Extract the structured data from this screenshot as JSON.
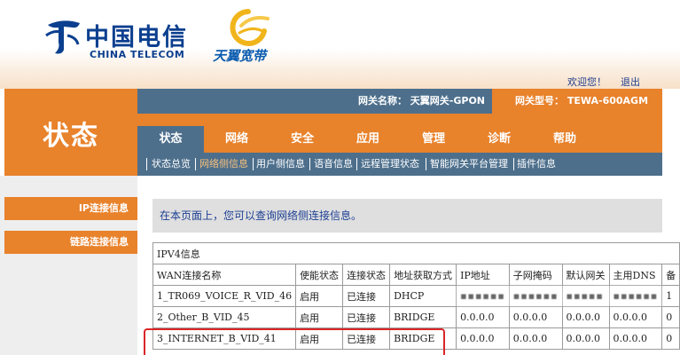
{
  "header": {
    "logo_cn": "中国电信",
    "logo_en": "CHINA TELECOM",
    "brand": "天翼宽带",
    "welcome": "欢迎您！",
    "logout": "退出",
    "colors": {
      "primary_orange": "#e8822b",
      "steel_blue": "#4d6f8c",
      "logo_blue": "#0b3f8f"
    }
  },
  "page_title": "状态",
  "info": {
    "gateway_name": "网关名称：  天翼网关-GPON",
    "gateway_model": "网关型号：  TEWA-600AGM"
  },
  "tabs": [
    "状态",
    "网络",
    "安全",
    "应用",
    "管理",
    "诊断",
    "帮助"
  ],
  "active_tab": "状态",
  "subnav": [
    "状态总览",
    "网络侧信息",
    "用户侧信息",
    "语音信息",
    "远程管理状态",
    "智能网关平台管理",
    "插件信息"
  ],
  "active_subnav": "网络侧信息",
  "sidebar": [
    "IP连接信息",
    "链路连接信息"
  ],
  "notice": "在本页面上，您可以查询网络侧连接信息。",
  "table": {
    "caption": "IPV4信息",
    "headers": [
      "WAN连接名称",
      "使能状态",
      "连接状态",
      "地址获取方式",
      "IP地址",
      "子网掩码",
      "默认网关",
      "主用DNS",
      "备"
    ],
    "rows": [
      [
        "1_TR069_VOICE_R_VID_46",
        "启用",
        "已连接",
        "DHCP",
        "▪▪▪▪▪▪",
        "▪▪▪▪▪▪",
        "▪▪▪▪▪",
        "▪▪▪▪▪▪",
        "1"
      ],
      [
        "2_Other_B_VID_45",
        "启用",
        "已连接",
        "BRIDGE",
        "0.0.0.0",
        "0.0.0.0",
        "0.0.0.0",
        "0.0.0.0",
        "0"
      ],
      [
        "3_INTERNET_B_VID_41",
        "启用",
        "已连接",
        "BRIDGE",
        "0.0.0.0",
        "0.0.0.0",
        "0.0.0.0",
        "0.0.0.0",
        "0"
      ]
    ]
  }
}
